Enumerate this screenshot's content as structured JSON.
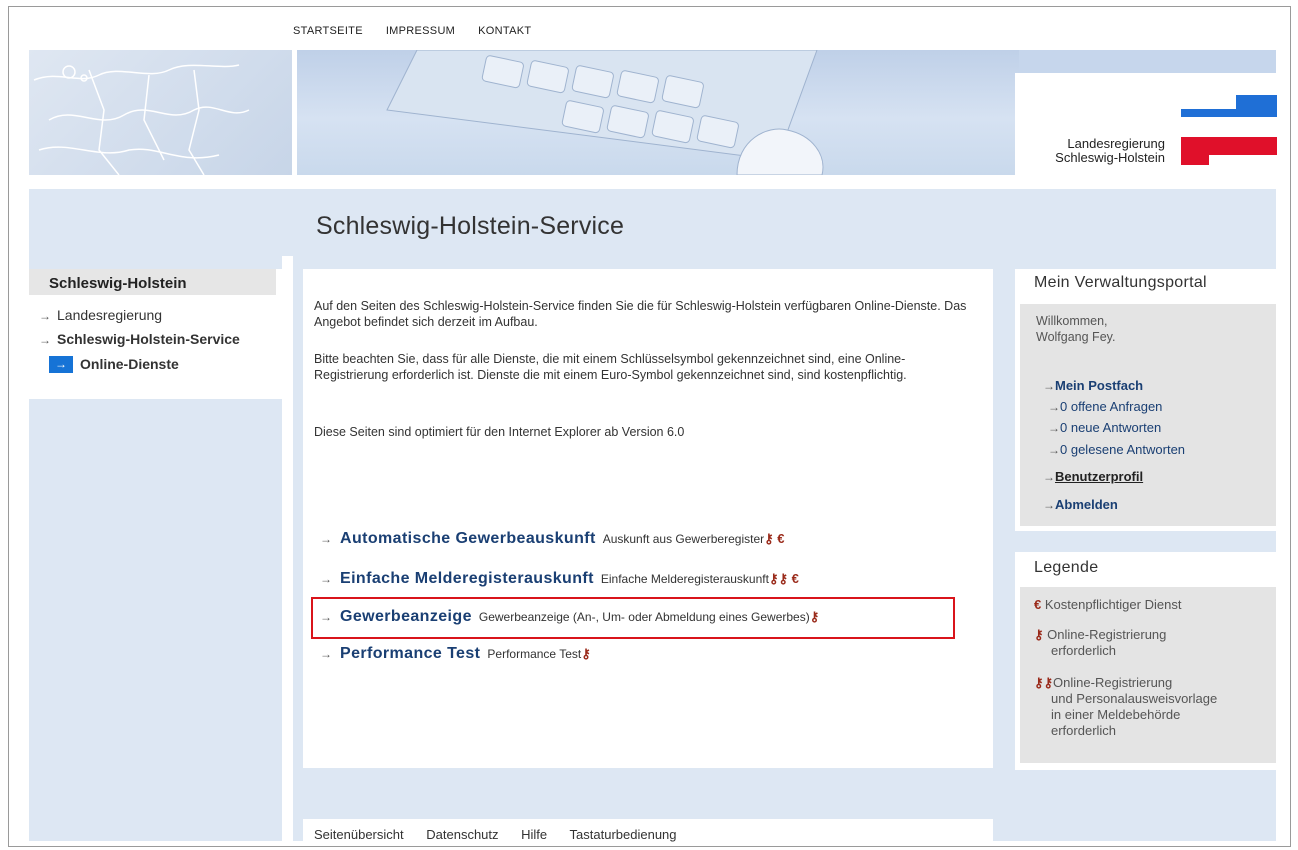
{
  "top_nav": [
    "STARTSEITE",
    "IMPRESSUM",
    "KONTAKT"
  ],
  "logo": {
    "line1": "Landesregierung",
    "line2": "Schleswig-Holstein"
  },
  "page_title": "Schleswig-Holstein-Service",
  "left_nav": {
    "heading": "Schleswig-Holstein",
    "items": [
      "Landesregierung",
      "Schleswig-Holstein-Service"
    ],
    "active_item": "Online-Dienste"
  },
  "intro": {
    "p1": "Auf den Seiten des Schleswig-Holstein-Service finden Sie die für Schleswig-Holstein verfügbaren Online-Dienste. Das Angebot befindet sich derzeit im Aufbau.",
    "p2": "Bitte beachten Sie, dass für alle Dienste, die mit einem Schlüsselsymbol gekennzeichnet sind, eine Online-Registrierung erforderlich ist. Dienste die mit einem Euro-Symbol gekennzeichnet sind, sind kostenpflichtig.",
    "p3": "Diese Seiten sind optimiert für den Internet Explorer ab Version 6.0"
  },
  "services": [
    {
      "title": "Automatische Gewerbeauskunft",
      "desc": "Auskunft aus Gewerberegister"
    },
    {
      "title": "Einfache Melderegisterauskunft",
      "desc": "Einfache Melderegisterauskunft"
    },
    {
      "title": "Gewerbeanzeige",
      "desc": "Gewerbeanzeige (An-, Um- oder Abmeldung eines Gewerbes)"
    },
    {
      "title": "Performance Test",
      "desc": "Performance Test"
    }
  ],
  "footer_links": [
    "Seitenübersicht",
    "Datenschutz",
    "Hilfe",
    "Tastaturbedienung"
  ],
  "portal": {
    "heading": "Mein Verwaltungsportal",
    "welcome": "Willkommen,",
    "user": "Wolfgang Fey.",
    "postfach": "Mein Postfach",
    "sub_links": [
      "0 offene Anfragen",
      "0 neue Antworten",
      "0 gelesene Antworten"
    ],
    "profile": "Benutzerprofil",
    "logout": "Abmelden"
  },
  "legend": {
    "heading": "Legende",
    "euro_symbol": "€",
    "euro": "Kostenpflichtiger Dienst",
    "key1_l1": "Online-Registrierung",
    "key1_l2": "erforderlich",
    "key2_l1": "Online-Registrierung",
    "key2_l2": "und Personalausweisvorlage",
    "key2_l3": "in einer Meldebehörde",
    "key2_l4": "erforderlich"
  },
  "colors": {
    "link": "#1a3f73",
    "accent_blue": "#1673d6",
    "highlight_red": "#d9141b",
    "band": "#dde7f3"
  }
}
